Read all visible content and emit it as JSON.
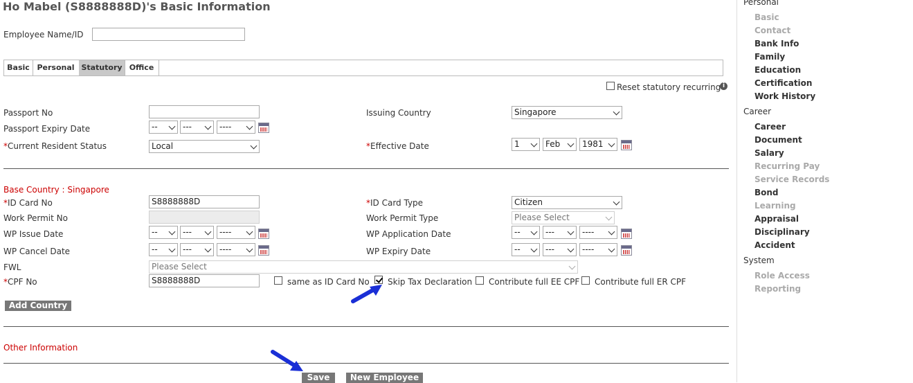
{
  "page": {
    "title": "Ho Mabel (S8888888D)'s Basic Information",
    "employee_label": "Employee Name/ID",
    "employee_value": ""
  },
  "tabs": [
    {
      "label": "Basic",
      "active": false
    },
    {
      "label": "Personal",
      "active": false
    },
    {
      "label": "Statutory",
      "active": true
    },
    {
      "label": "Office",
      "active": false
    }
  ],
  "reset": {
    "label": "Reset statutory recurring",
    "checked": false,
    "info_icon": "info-icon"
  },
  "passport": {
    "passport_no_label": "Passport No",
    "passport_no_value": "",
    "expiry_label": "Passport Expiry Date",
    "expiry_day": "--",
    "expiry_month": "---",
    "expiry_year": "----",
    "resident_label": "Current Resident Status",
    "resident_value": "Local",
    "issuing_label": "Issuing Country",
    "issuing_value": "Singapore",
    "effective_label": "Effective Date",
    "effective_day": "1",
    "effective_month": "Feb",
    "effective_year": "1981"
  },
  "base": {
    "heading": "Base Country : Singapore",
    "id_card_label": "ID Card No",
    "id_card_value": "S8888888D",
    "id_type_label": "ID Card Type",
    "id_type_value": "Citizen",
    "wp_no_label": "Work Permit No",
    "wp_no_value": "",
    "wp_type_label": "Work Permit Type",
    "wp_type_value": "Please Select",
    "wp_issue_label": "WP Issue Date",
    "wp_app_label": "WP Application Date",
    "wp_cancel_label": "WP Cancel Date",
    "wp_expiry_label": "WP Expiry Date",
    "date_day": "--",
    "date_month": "---",
    "date_year": "----",
    "fwl_label": "FWL",
    "fwl_value": "Please Select",
    "cpf_label": "CPF No",
    "cpf_value": "S8888888D",
    "same_as_label": "same as ID Card No",
    "skip_tax_label": "Skip Tax Declaration",
    "full_ee_label": "Contribute full EE CPF",
    "full_er_label": "Contribute full ER CPF",
    "add_country_label": "Add Country"
  },
  "other": {
    "heading": "Other Information"
  },
  "actions": {
    "save_label": "Save",
    "new_employee_label": "New Employee"
  },
  "sidebar": {
    "sections": [
      {
        "title": "Personal",
        "items": [
          {
            "label": "Basic",
            "enabled": false
          },
          {
            "label": "Contact",
            "enabled": false
          },
          {
            "label": "Bank Info",
            "enabled": true
          },
          {
            "label": "Family",
            "enabled": true
          },
          {
            "label": "Education",
            "enabled": true
          },
          {
            "label": "Certification",
            "enabled": true
          },
          {
            "label": "Work History",
            "enabled": true
          }
        ]
      },
      {
        "title": "Career",
        "items": [
          {
            "label": "Career",
            "enabled": true
          },
          {
            "label": "Document",
            "enabled": true
          },
          {
            "label": "Salary",
            "enabled": true
          },
          {
            "label": "Recurring Pay",
            "enabled": false
          },
          {
            "label": "Service Records",
            "enabled": false
          },
          {
            "label": "Bond",
            "enabled": true
          },
          {
            "label": "Learning",
            "enabled": false
          },
          {
            "label": "Appraisal",
            "enabled": true
          },
          {
            "label": "Disciplinary",
            "enabled": true
          },
          {
            "label": "Accident",
            "enabled": true
          }
        ]
      },
      {
        "title": "System",
        "items": [
          {
            "label": "Role Access",
            "enabled": false
          },
          {
            "label": "Reporting",
            "enabled": false
          }
        ]
      }
    ]
  },
  "colors": {
    "required": "#cc0000",
    "button": "#777777",
    "tab_active": "#c8c8c8",
    "annotation_arrow": "#1a2fd6"
  }
}
